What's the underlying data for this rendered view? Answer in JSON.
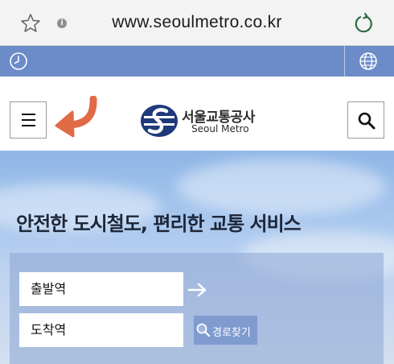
{
  "browser": {
    "url": "www.seoulmetro.co.kr",
    "info_glyph": "i",
    "icons": [
      "star-icon",
      "info-icon",
      "reload-icon"
    ]
  },
  "utility_bar": {
    "icons": [
      "clock-icon",
      "globe-icon"
    ],
    "color": "#6b8bc9"
  },
  "header": {
    "brand_korean": "서울교통공사",
    "brand_english": "Seoul Metro",
    "icons": [
      "menu-icon",
      "curved-arrow-icon",
      "seoul-metro-logo",
      "search-icon"
    ],
    "arrow_color": "#e06a45",
    "logo_color": "#1f3a7a"
  },
  "hero": {
    "tagline": "안전한 도시철도, 편리한 교통 서비스",
    "departure_label": "출발역",
    "arrival_label": "도착역",
    "route_button_label": "경로찾기",
    "icons": [
      "arrow-right-icon",
      "magnifier-icon"
    ]
  }
}
